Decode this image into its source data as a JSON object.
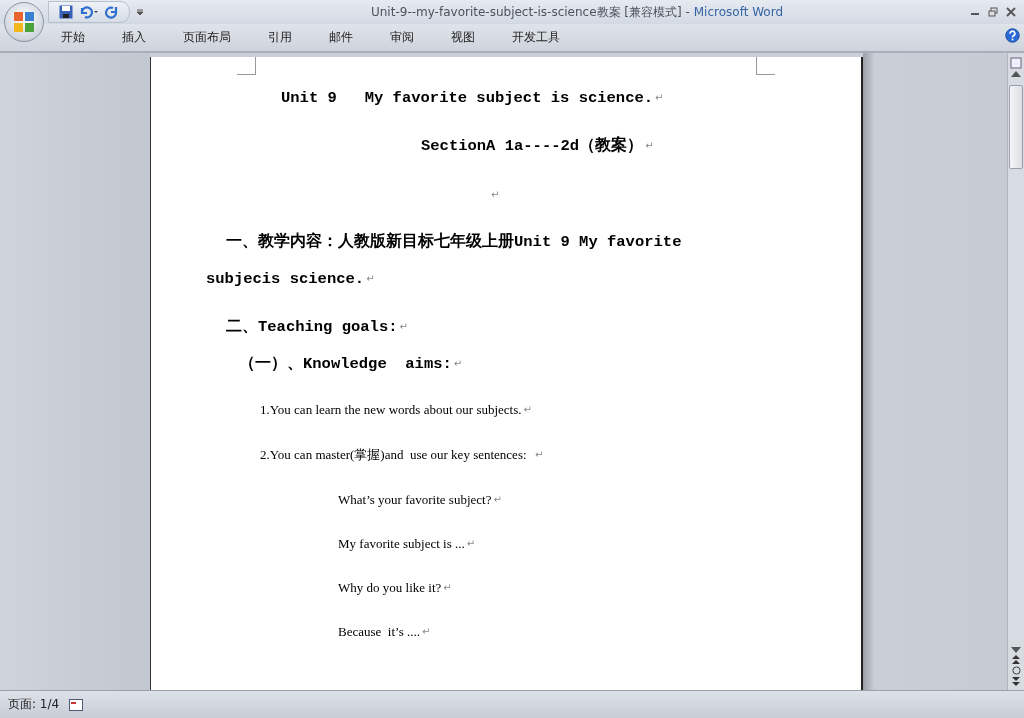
{
  "window": {
    "title": "Unit-9--my-favorite-subject-is-science教案 [兼容模式]",
    "separator": "-",
    "app_name": "Microsoft Word"
  },
  "ribbon_tabs": [
    {
      "label": "开始",
      "selected": false
    },
    {
      "label": "插入",
      "selected": false
    },
    {
      "label": "页面布局",
      "selected": false
    },
    {
      "label": "引用",
      "selected": false
    },
    {
      "label": "邮件",
      "selected": false
    },
    {
      "label": "审阅",
      "selected": false
    },
    {
      "label": "视图",
      "selected": false
    },
    {
      "label": "开发工具",
      "selected": false
    }
  ],
  "document": {
    "paragraphs": [
      {
        "kind": "title",
        "text": "Unit 9   My favorite subject is science.",
        "mark": "↵"
      },
      {
        "kind": "subtitle",
        "text": "SectionA 1a----2d（教案）",
        "mark": "↵"
      },
      {
        "kind": "blank",
        "mark": "↵"
      },
      {
        "kind": "heading",
        "text": "一、教学内容：人教版新目标七年级上册Unit 9 My favorite"
      },
      {
        "kind": "continuation",
        "text": "subjecis science.",
        "mark": "↵"
      },
      {
        "kind": "heading",
        "text": "二、Teaching goals:",
        "mark": "↵"
      },
      {
        "kind": "subheading",
        "text": "（一）、Knowledge  aims:",
        "mark": "↵"
      },
      {
        "kind": "item",
        "text": "1.You can learn the new words about our subjects.",
        "mark": "↵"
      },
      {
        "kind": "item",
        "text": "2.You can master(掌握)and  use our key sentences:  ",
        "mark": "↵"
      },
      {
        "kind": "example",
        "text": "What’s your favorite subject?",
        "mark": "↵"
      },
      {
        "kind": "example",
        "text": "My favorite subject is ...",
        "mark": "↵"
      },
      {
        "kind": "example",
        "text": "Why do you like it?",
        "mark": "↵"
      },
      {
        "kind": "example",
        "text": "Because  it’s ....",
        "mark": "↵"
      }
    ]
  },
  "status_bar": {
    "page": "页面: 1/4"
  }
}
